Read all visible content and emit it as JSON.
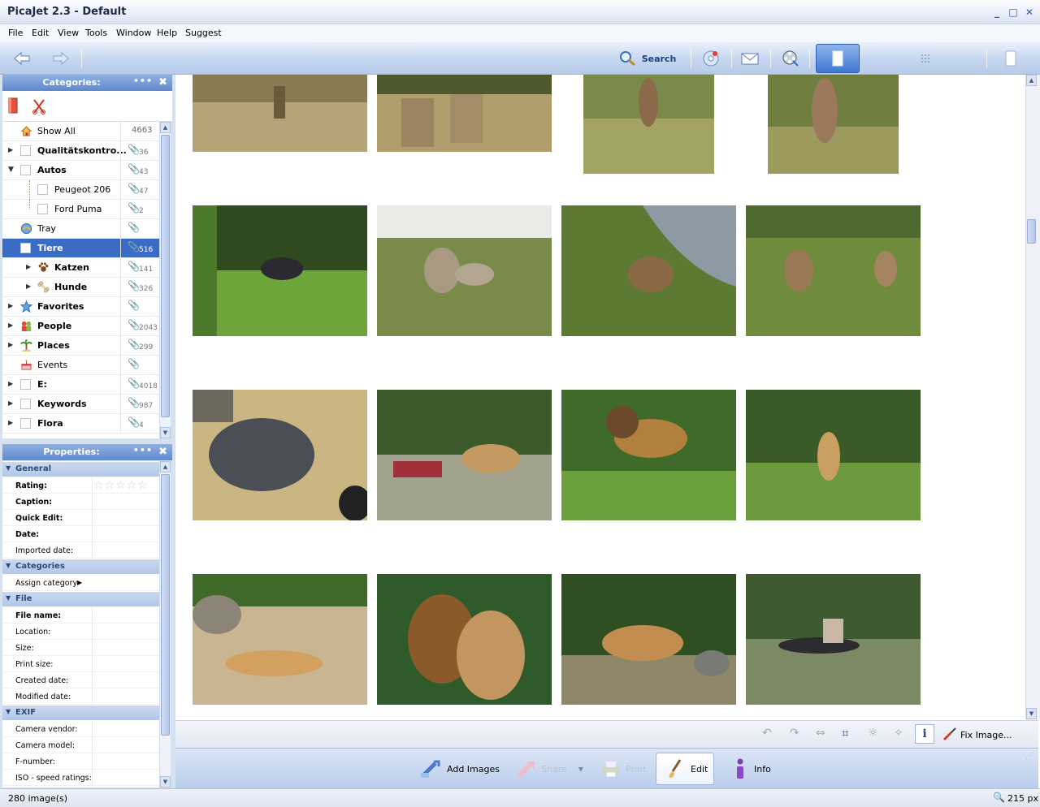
{
  "window": {
    "title": "PicaJet 2.3 - Default"
  },
  "menu": [
    "File",
    "Edit",
    "View",
    "Tools",
    "Window",
    "Help",
    "Suggest"
  ],
  "toolbar": {
    "back_icon": "back-arrow-icon",
    "forward_icon": "forward-arrow-icon",
    "search_label": "Search"
  },
  "categories_panel": {
    "title": "Categories:",
    "items": [
      {
        "label": "Show All",
        "count": "4663",
        "bold": false,
        "expandable": false,
        "icon": "house-icon"
      },
      {
        "label": "Qualitätskontro...",
        "count": "36",
        "bold": true,
        "expandable": true,
        "icon": "checkbox"
      },
      {
        "label": "Autos",
        "count": "43",
        "bold": true,
        "expandable": true,
        "expanded": true,
        "icon": "checkbox"
      },
      {
        "label": "Peugeot 206",
        "count": "47",
        "bold": false,
        "child": true,
        "icon": "checkbox"
      },
      {
        "label": "Ford Puma",
        "count": "2",
        "bold": false,
        "child": true,
        "icon": "checkbox"
      },
      {
        "label": "Tray",
        "count": "",
        "bold": false,
        "icon": "tray-icon"
      },
      {
        "label": "Tiere",
        "count": "516",
        "bold": true,
        "selected": true,
        "icon": "checkbox"
      },
      {
        "label": "Katzen",
        "count": "141",
        "bold": true,
        "child": true,
        "expandable": true,
        "icon": "paw-icon"
      },
      {
        "label": "Hunde",
        "count": "326",
        "bold": true,
        "child": true,
        "expandable": true,
        "icon": "bone-icon"
      },
      {
        "label": "Favorites",
        "count": "",
        "bold": true,
        "expandable": true,
        "icon": "star-icon"
      },
      {
        "label": "People",
        "count": "2043",
        "bold": true,
        "expandable": true,
        "icon": "people-icon"
      },
      {
        "label": "Places",
        "count": "299",
        "bold": true,
        "expandable": true,
        "icon": "palm-icon"
      },
      {
        "label": "Events",
        "count": "",
        "bold": false,
        "icon": "cake-icon"
      },
      {
        "label": "E:",
        "count": "4018",
        "bold": true,
        "expandable": true,
        "icon": "checkbox"
      },
      {
        "label": "Keywords",
        "count": "987",
        "bold": true,
        "expandable": true,
        "icon": "checkbox"
      },
      {
        "label": "Flora",
        "count": "4",
        "bold": true,
        "expandable": true,
        "icon": "checkbox"
      }
    ]
  },
  "properties_panel": {
    "title": "Properties:",
    "general": "General",
    "rating": "Rating:",
    "caption": "Caption:",
    "quick_edit": "Quick Edit:",
    "date": "Date:",
    "imported_date": "Imported date:",
    "categories": "Categories",
    "assign_category": "Assign category",
    "file": "File",
    "file_name": "File name:",
    "location": "Location:",
    "size": "Size:",
    "print_size": "Print size:",
    "created_date": "Created date:",
    "modified_date": "Modified date:",
    "exif": "EXIF",
    "camera_vendor": "Camera vendor:",
    "camera_model": "Camera model:",
    "f_number": "F-number:",
    "iso": "ISO - speed ratings:"
  },
  "edit_strip": {
    "fix_image": "Fix Image..."
  },
  "bottom_bar": {
    "add_images": "Add Images",
    "share": "Share",
    "print": "Print",
    "edit": "Edit",
    "info": "Info"
  },
  "status": {
    "count": "280 image(s)",
    "zoom": "215 px"
  },
  "colors": {
    "accent": "#3a6cc4",
    "panel_header": "#6f95d6"
  }
}
